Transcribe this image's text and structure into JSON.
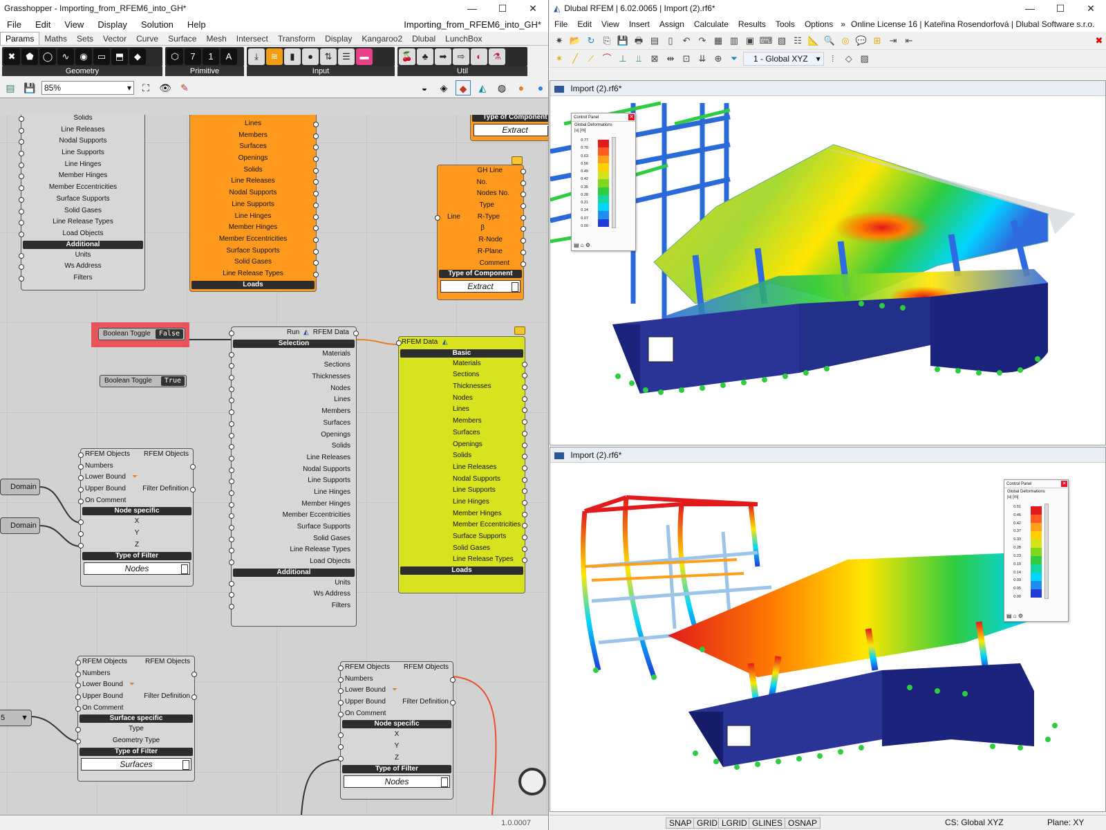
{
  "gh": {
    "title": "Grasshopper - Importing_from_RFEM6_into_GH*",
    "menu": [
      "File",
      "Edit",
      "View",
      "Display",
      "Solution",
      "Help"
    ],
    "doc_name": "Importing_from_RFEM6_into_GH*",
    "tabs": [
      "Params",
      "Maths",
      "Sets",
      "Vector",
      "Curve",
      "Surface",
      "Mesh",
      "Intersect",
      "Transform",
      "Display",
      "Kangaroo2",
      "Dlubal",
      "LunchBox"
    ],
    "ribbon_groups": [
      "Geometry",
      "Primitive",
      "Input",
      "Util"
    ],
    "zoom": "85%",
    "version": "1.0.0007",
    "comp_left_top": {
      "rows": [
        "Solids",
        "Line Releases",
        "Nodal Supports",
        "Line Supports",
        "Line Hinges",
        "Member Hinges",
        "Member Eccentricities",
        "Surface Supports",
        "Solid Gases",
        "Line Release Types",
        "Load Objects"
      ],
      "section": "Additional",
      "rows2": [
        "Units",
        "Ws Address",
        "Filters"
      ]
    },
    "comp_orange": {
      "rows": [
        "Lines",
        "Members",
        "Surfaces",
        "Openings",
        "Solids",
        "Line Releases",
        "Nodal Supports",
        "Line Supports",
        "Line Hinges",
        "Member Hinges",
        "Member Eccentricities",
        "Surface Supports",
        "Solid Gases",
        "Line Release Types"
      ],
      "footer": "Loads"
    },
    "comp_extract_top": {
      "header": "Type of Component",
      "value": "Extract"
    },
    "comp_line": {
      "input": "Line",
      "rows": [
        "GH Line",
        "No.",
        "Nodes No.",
        "Type",
        "R-Type",
        "β",
        "R-Node",
        "R-Plane",
        "Comment"
      ],
      "section": "Type of Component",
      "value": "Extract"
    },
    "toggle_false": {
      "label": "Boolean Toggle",
      "value": "False"
    },
    "toggle_true": {
      "label": "Boolean Toggle",
      "value": "True"
    },
    "comp_run": {
      "input": "Run",
      "output": "RFEM Data",
      "section": "Selection",
      "rows": [
        "Materials",
        "Sections",
        "Thicknesses",
        "Nodes",
        "Lines",
        "Members",
        "Surfaces",
        "Openings",
        "Solids",
        "Line Releases",
        "Nodal Supports",
        "Line Supports",
        "Line Hinges",
        "Member Hinges",
        "Member Eccentricities",
        "Surface Supports",
        "Solid Gases",
        "Line Release Types",
        "Load Objects"
      ],
      "section2": "Additional",
      "rows2": [
        "Units",
        "Ws Address",
        "Filters"
      ]
    },
    "comp_lime": {
      "input": "RFEM Data",
      "section": "Basic",
      "rows": [
        "Materials",
        "Sections",
        "Thicknesses",
        "Nodes",
        "Lines",
        "Members",
        "Surfaces",
        "Openings",
        "Solids",
        "Line Releases",
        "Nodal Supports",
        "Line Supports",
        "Line Hinges",
        "Member Hinges",
        "Member Eccentricities",
        "Surface Supports",
        "Solid Gases",
        "Line Release Types"
      ],
      "footer": "Loads"
    },
    "domains": [
      "Domain",
      "Domain"
    ],
    "filter_nodes_1": {
      "inputs": [
        "RFEM Objects",
        "Numbers",
        "Lower Bound",
        "Upper Bound",
        "On Comment"
      ],
      "outputs": [
        "RFEM Objects",
        "Filter Definition"
      ],
      "section": "Node specific",
      "rows": [
        "X",
        "Y",
        "Z"
      ],
      "type_header": "Type of Filter",
      "value": "Nodes"
    },
    "filter_surfaces": {
      "inputs": [
        "RFEM Objects",
        "Numbers",
        "Lower Bound",
        "Upper Bound",
        "On Comment"
      ],
      "outputs": [
        "RFEM Objects",
        "Filter Definition"
      ],
      "section": "Surface specific",
      "rows": [
        "Type",
        "Geometry Type"
      ],
      "type_header": "Type of Filter",
      "value": "Surfaces"
    },
    "filter_nodes_2": {
      "inputs": [
        "RFEM Objects",
        "Numbers",
        "Lower Bound",
        "Upper Bound",
        "On Comment"
      ],
      "outputs": [
        "RFEM Objects",
        "Filter Definition"
      ],
      "section": "Node specific",
      "rows": [
        "X",
        "Y",
        "Z"
      ],
      "type_header": "Type of Filter",
      "value": "Nodes"
    },
    "value_list_partial": "5"
  },
  "rf": {
    "title": "Dlubal RFEM | 6.02.0065 | Import (2).rf6*",
    "menu": [
      "File",
      "Edit",
      "View",
      "Insert",
      "Assign",
      "Calculate",
      "Results",
      "Tools",
      "Options"
    ],
    "license": "Online License 16 | Kateřina Rosendorfová | Dlubal Software s.r.o.",
    "cs_select": "1 - Global XYZ",
    "view1_title": "Import (2).rf6*",
    "view2_title": "Import (2).rf6*",
    "cp1": {
      "title": "Control Panel",
      "subtitle": "Global Deformations",
      "unit": "|u| [m]",
      "ticks": [
        "0.77",
        "0.70",
        "0.63",
        "0.56",
        "0.49",
        "0.42",
        "0.35",
        "0.28",
        "0.21",
        "0.14",
        "0.07",
        "0.00"
      ]
    },
    "cp2": {
      "title": "Control Panel",
      "subtitle": "Global Deformations",
      "unit": "|u| [m]",
      "ticks": [
        "0.51",
        "0.46",
        "0.42",
        "0.37",
        "0.33",
        "0.28",
        "0.23",
        "0.19",
        "0.14",
        "0.09",
        "0.05",
        "0.00"
      ]
    },
    "status": [
      "SNAP",
      "GRID",
      "LGRID",
      "GLINES",
      "OSNAP"
    ],
    "cs": "CS: Global XYZ",
    "plane": "Plane: XY",
    "colors": {
      "red": "#e31a1c",
      "orange": "#ff7f00",
      "yellow": "#ffe600",
      "green": "#2ecc40",
      "cyan": "#00d5ff",
      "blue": "#1f3bd8",
      "navy": "#1b237d"
    }
  }
}
